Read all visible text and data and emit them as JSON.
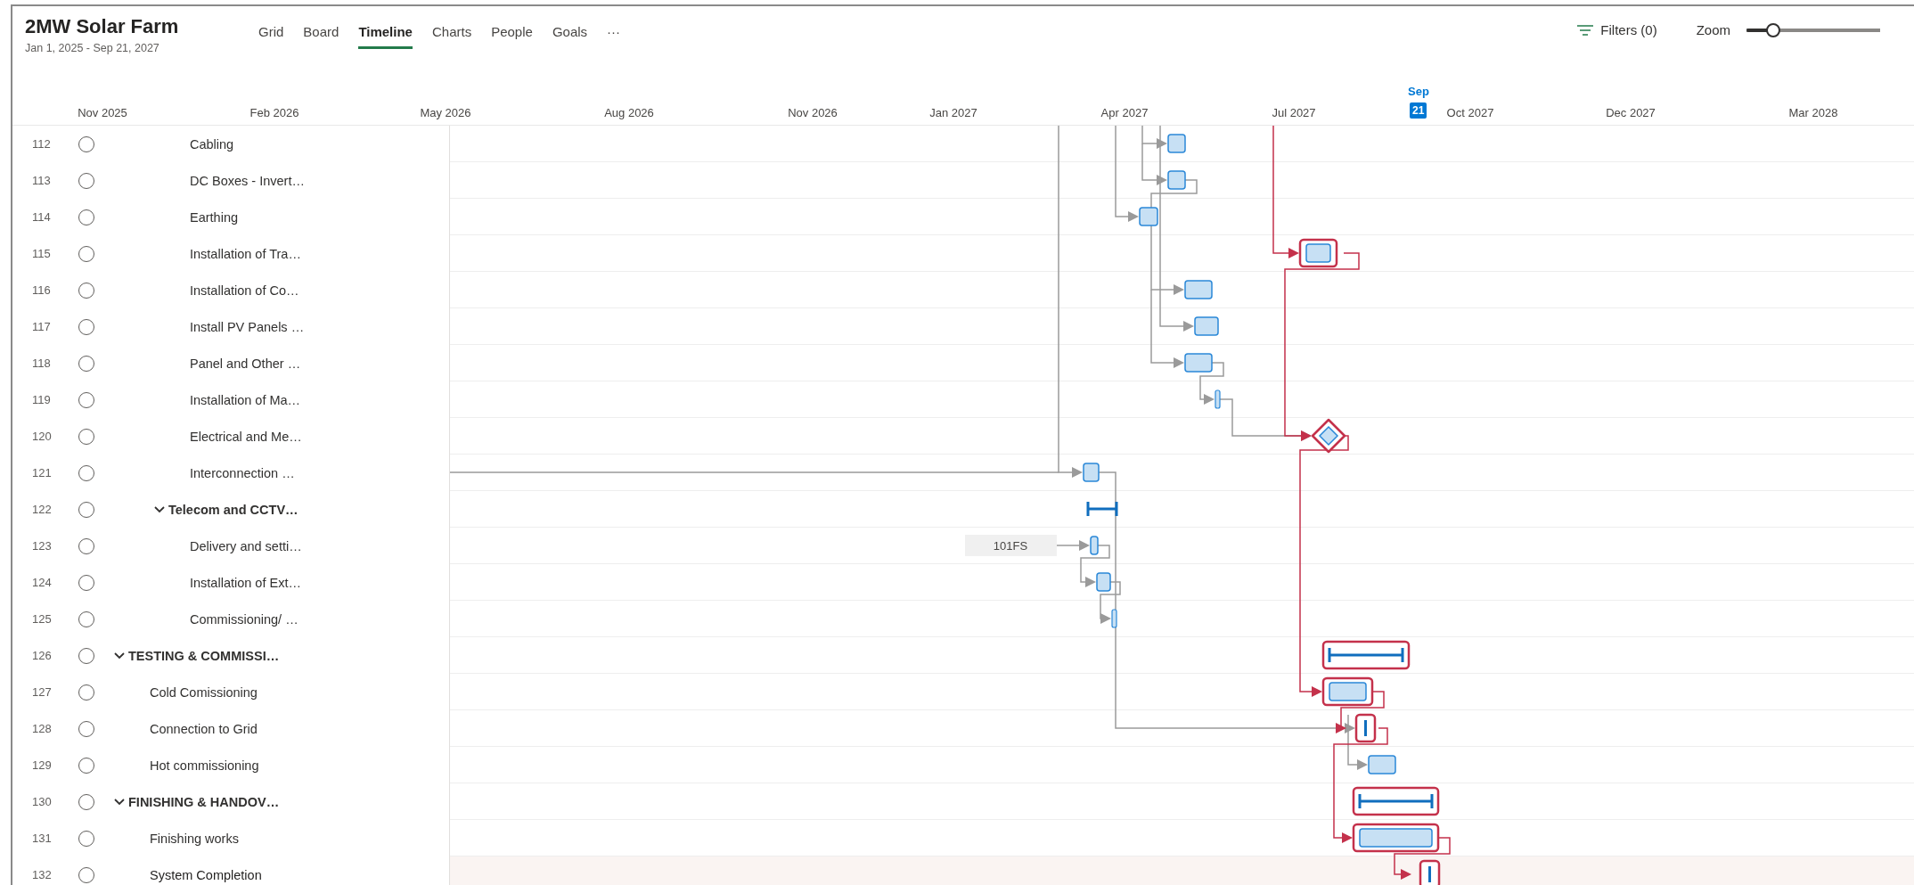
{
  "project": {
    "title": "2MW Solar Farm",
    "dates": "Jan 1, 2025 - Sep 21, 2027"
  },
  "tabs": [
    {
      "label": "Grid",
      "selected": false
    },
    {
      "label": "Board",
      "selected": false
    },
    {
      "label": "Timeline",
      "selected": true
    },
    {
      "label": "Charts",
      "selected": false
    },
    {
      "label": "People",
      "selected": false
    },
    {
      "label": "Goals",
      "selected": false
    },
    {
      "label": "···",
      "selected": false
    }
  ],
  "filters": {
    "label": "Filters (0)"
  },
  "zoom": {
    "label": "Zoom",
    "level": 0.2
  },
  "timeline": {
    "months": [
      "Nov 2025",
      "Feb 2026",
      "May 2026",
      "Aug 2026",
      "Nov 2026",
      "Jan 2027",
      "Apr 2027",
      "Jul 2027",
      "Oct 2027",
      "Dec 2027",
      "Mar 2028"
    ],
    "today": {
      "month": "Sep",
      "day": "21"
    }
  },
  "rows": [
    {
      "children": [
        {
          "children": [
            {
              "number": "112",
              "title": "Cabling",
              "done": false,
              "highlighted": false,
              "bar": {
                "kind": "task",
                "critical": false
              }
            },
            {
              "number": "113",
              "title": "DC Boxes - Invert…",
              "done": false,
              "highlighted": false,
              "bar": {
                "kind": "task",
                "critical": false
              }
            },
            {
              "number": "114",
              "title": "Earthing",
              "done": false,
              "highlighted": false,
              "bar": {
                "kind": "task",
                "critical": false
              }
            },
            {
              "number": "115",
              "title": "Installation of Tra…",
              "done": false,
              "highlighted": false,
              "bar": {
                "kind": "task",
                "critical": true
              }
            },
            {
              "number": "116",
              "title": "Installation of Co…",
              "done": false,
              "highlighted": false,
              "bar": {
                "kind": "task",
                "critical": false
              }
            },
            {
              "number": "117",
              "title": "Install PV Panels …",
              "done": false,
              "highlighted": false,
              "bar": {
                "kind": "task",
                "critical": false
              }
            },
            {
              "number": "118",
              "title": "Panel and Other …",
              "done": false,
              "highlighted": false,
              "bar": {
                "kind": "task",
                "critical": false
              }
            },
            {
              "number": "119",
              "title": "Installation of Ma…",
              "done": false,
              "highlighted": false,
              "bar": {
                "kind": "thin",
                "critical": false
              }
            },
            {
              "number": "120",
              "title": "Electrical and Me…",
              "done": false,
              "highlighted": false,
              "bar": {
                "kind": "milestone",
                "critical": true
              }
            },
            {
              "number": "121",
              "title": "Interconnection …",
              "done": false,
              "highlighted": false,
              "bar": {
                "kind": "task",
                "critical": false
              }
            }
          ]
        },
        {
          "number": "122",
          "title": "Telecom and CCTV…",
          "done": false,
          "highlighted": false,
          "expanded": true,
          "bar": {
            "kind": "summary",
            "critical": false
          },
          "children": [
            {
              "number": "123",
              "title": "Delivery and setti…",
              "done": false,
              "highlighted": false,
              "bar": {
                "kind": "task",
                "critical": false
              },
              "lag_label": "101FS"
            },
            {
              "number": "124",
              "title": "Installation of Ext…",
              "done": false,
              "highlighted": false,
              "bar": {
                "kind": "task",
                "critical": false
              }
            },
            {
              "number": "125",
              "title": "Commissioning/ …",
              "done": false,
              "highlighted": false,
              "bar": {
                "kind": "thin",
                "critical": false
              }
            }
          ]
        }
      ]
    },
    {
      "number": "126",
      "title": "TESTING & COMMISSI…",
      "done": false,
      "highlighted": false,
      "expanded": true,
      "bar": {
        "kind": "summary",
        "critical": true
      },
      "children": [
        {
          "number": "127",
          "title": "Cold Comissioning",
          "done": false,
          "highlighted": false,
          "bar": {
            "kind": "task",
            "critical": true
          }
        },
        {
          "number": "128",
          "title": "Connection to Grid",
          "done": false,
          "highlighted": false,
          "bar": {
            "kind": "thin",
            "critical": true
          }
        },
        {
          "number": "129",
          "title": "Hot commissioning",
          "done": false,
          "highlighted": false,
          "bar": {
            "kind": "task",
            "critical": false
          }
        }
      ]
    },
    {
      "number": "130",
      "title": "FINISHING & HANDOV…",
      "done": false,
      "highlighted": false,
      "expanded": true,
      "bar": {
        "kind": "summary",
        "critical": true
      },
      "children": [
        {
          "number": "131",
          "title": "Finishing works",
          "done": false,
          "highlighted": false,
          "bar": {
            "kind": "task",
            "critical": true
          }
        },
        {
          "number": "132",
          "title": "System Completion",
          "done": false,
          "highlighted": true,
          "bar": {
            "kind": "thin",
            "critical": true
          }
        }
      ]
    }
  ]
}
